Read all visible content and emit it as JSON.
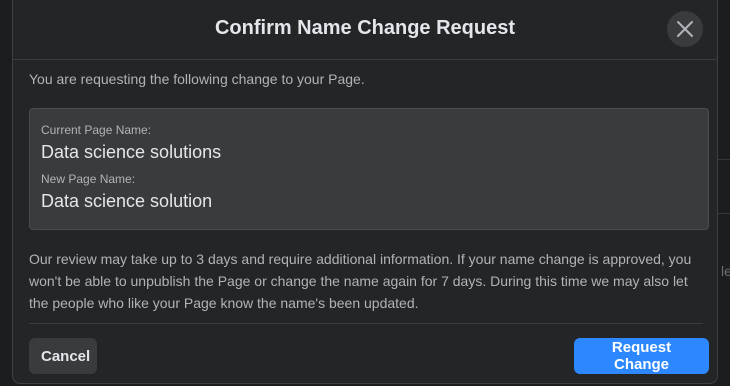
{
  "dialog": {
    "title": "Confirm Name Change Request",
    "intro": "You are requesting the following change to your Page.",
    "current_label": "Current Page Name:",
    "current_value": "Data science solutions",
    "new_label": "New Page Name:",
    "new_value": "Data science solution",
    "review_note": "Our review may take up to 3 days and require additional information. If your name change is approved, you won't be able to unpublish the Page or change the name again for 7 days. During this time we may also let the people who like your Page know the name's been updated.",
    "cancel_label": "Cancel",
    "request_label": "Request Change",
    "close_icon": "close-icon"
  },
  "background": {
    "right_edge_text": "le"
  },
  "colors": {
    "dialog_bg": "#242526",
    "box_bg": "#3a3b3c",
    "primary_button": "#2d88ff",
    "text_primary": "#e4e6eb",
    "text_secondary": "#b0b3b8"
  }
}
